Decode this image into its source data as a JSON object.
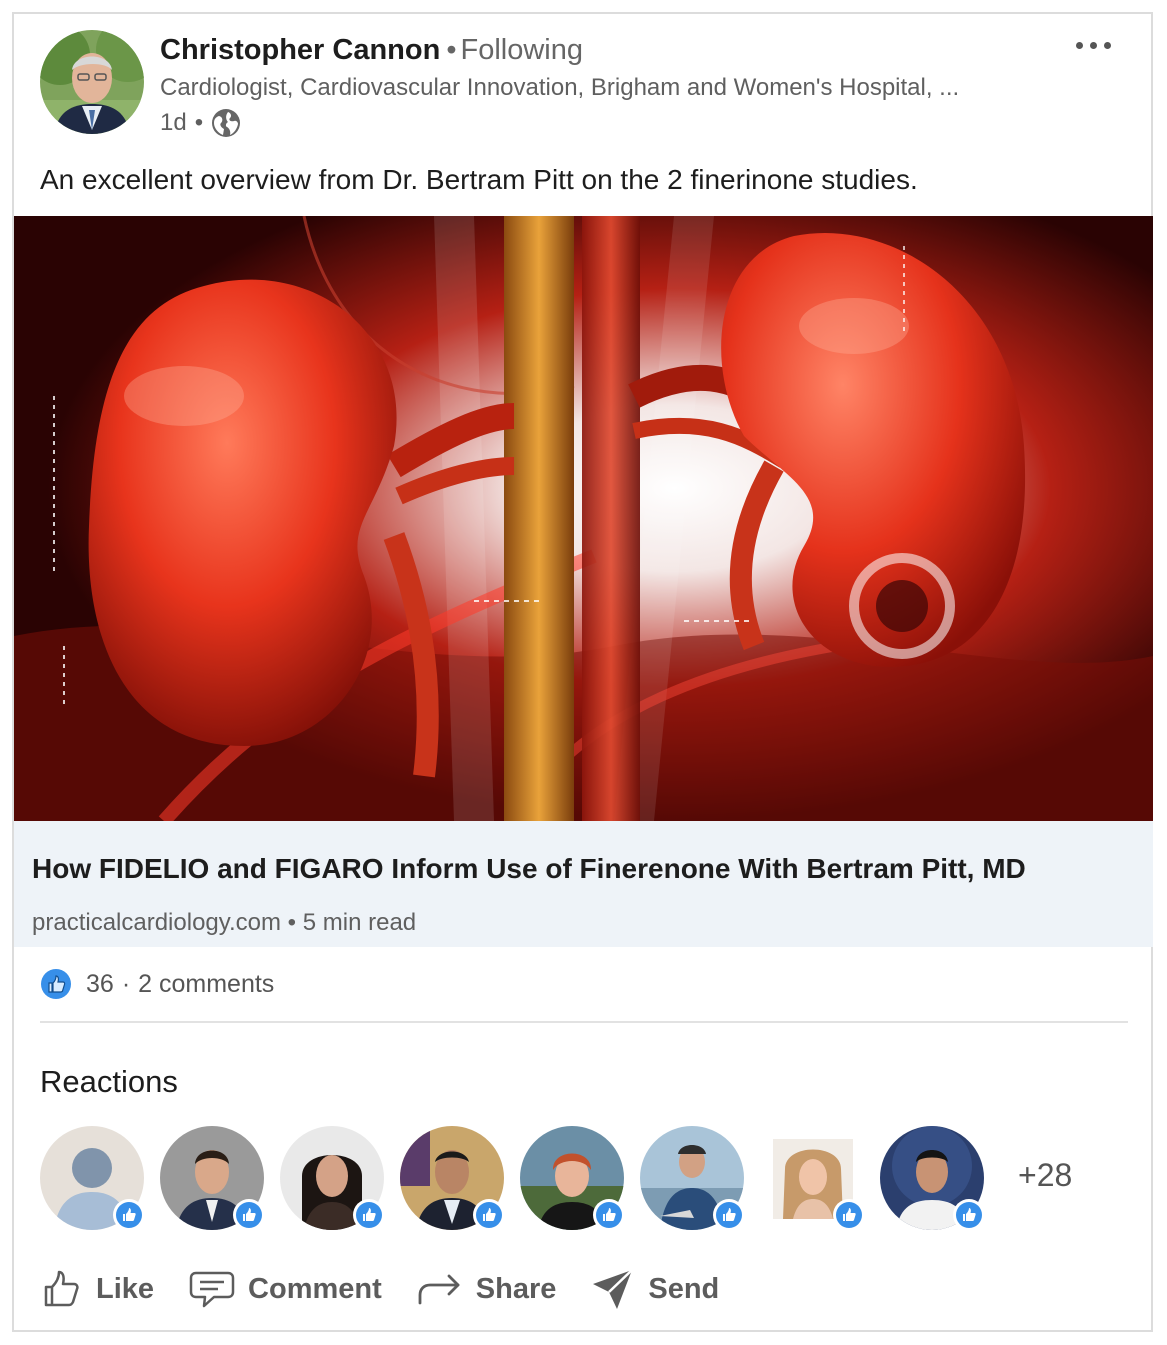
{
  "post": {
    "author": {
      "name": "Christopher Cannon",
      "separator": "•",
      "follow_status": "Following",
      "headline": "Cardiologist, Cardiovascular Innovation, Brigham and Women's Hospital, ...",
      "time": "1d",
      "time_separator": "•",
      "visibility_icon": "globe-icon"
    },
    "text": "An excellent overview from Dr. Bertram Pitt on the 2 finerinone studies.",
    "link_preview": {
      "title": "How FIDELIO and FIGARO Inform Use of Finerenone With Bertram Pitt, MD",
      "domain": "practicalcardiology.com",
      "separator": "•",
      "read_time": "5 min read"
    },
    "social": {
      "reaction_icon": "like-icon",
      "reaction_count": "36",
      "separator": "·",
      "comments": "2 comments"
    },
    "reactions": {
      "title": "Reactions",
      "more_count": "+28"
    },
    "actions": {
      "like": "Like",
      "comment": "Comment",
      "share": "Share",
      "send": "Send"
    }
  },
  "colors": {
    "like_blue": "#378fe9",
    "text_secondary": "#5f5f5f",
    "link_preview_bg": "#eef3f8",
    "image_red": "#e0301e"
  }
}
